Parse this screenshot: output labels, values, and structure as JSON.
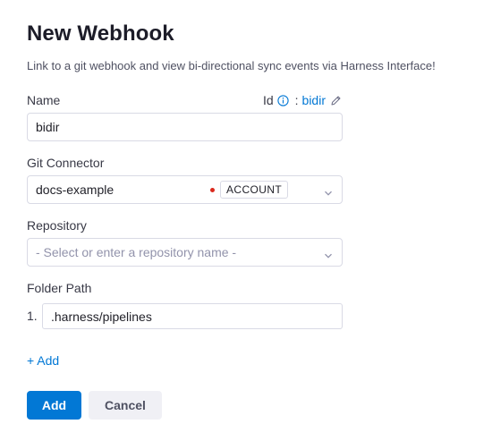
{
  "dialog": {
    "title": "New Webhook",
    "subtitle": "Link to a git webhook and view bi-directional sync events via Harness Interface!"
  },
  "name_field": {
    "label": "Name",
    "value": "bidir",
    "id_label": "Id",
    "id_value": "bidir"
  },
  "git_connector": {
    "label": "Git Connector",
    "value": "docs-example",
    "scope_badge": "ACCOUNT",
    "status_color": "#da291d"
  },
  "repository": {
    "label": "Repository",
    "placeholder": "- Select or enter a repository name -"
  },
  "folder_path": {
    "label": "Folder Path",
    "items": [
      {
        "index": "1.",
        "value": ".harness/pipelines"
      }
    ],
    "add_label": "+ Add"
  },
  "actions": {
    "submit_label": "Add",
    "cancel_label": "Cancel"
  },
  "colors": {
    "accent": "#0278d5",
    "text": "#22222a",
    "muted": "#9293ab",
    "border": "#d9dae5"
  }
}
